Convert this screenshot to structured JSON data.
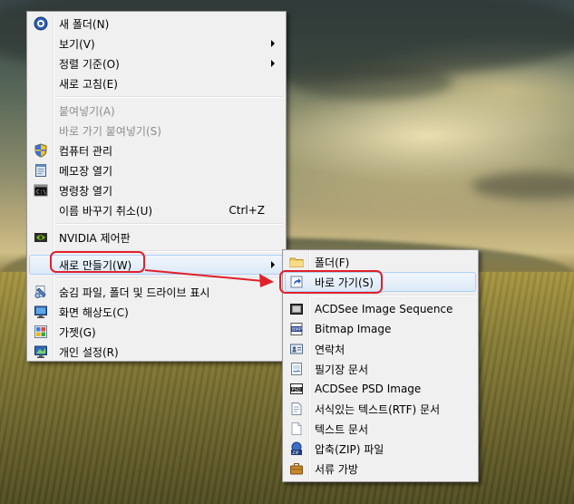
{
  "main_menu": {
    "items": [
      {
        "label": "새 폴더(N)",
        "icon": "new-folder-icon"
      },
      {
        "label": "보기(V)",
        "submenu": true
      },
      {
        "label": "정렬 기준(O)",
        "submenu": true
      },
      {
        "label": "새로 고침(E)"
      },
      {
        "label": "붙여넣기(A)",
        "disabled": true
      },
      {
        "label": "바로 가기 붙여넣기(S)",
        "disabled": true
      },
      {
        "label": "컴퓨터 관리",
        "icon": "shield-icon"
      },
      {
        "label": "메모장 열기",
        "icon": "notepad-icon"
      },
      {
        "label": "명령창 열기",
        "icon": "cmd-icon"
      },
      {
        "label": "이름 바꾸기 취소(U)",
        "shortcut": "Ctrl+Z"
      },
      {
        "label": "NVIDIA 제어판",
        "icon": "nvidia-icon"
      },
      {
        "label": "새로 만들기(W)",
        "submenu": true,
        "highlighted": true
      },
      {
        "label": "숨김 파일, 폴더 및 드라이브 표시",
        "icon": "hidden-files-icon"
      },
      {
        "label": "화면 해상도(C)",
        "icon": "display-icon"
      },
      {
        "label": "가젯(G)",
        "icon": "gadget-icon"
      },
      {
        "label": "개인 설정(R)",
        "icon": "personalize-icon"
      }
    ]
  },
  "new_submenu": {
    "items": [
      {
        "label": "폴더(F)",
        "icon": "folder-icon"
      },
      {
        "label": "바로 가기(S)",
        "icon": "shortcut-icon",
        "highlighted": true
      },
      {
        "label": "ACDSee Image Sequence",
        "icon": "acdsee-sequence-icon"
      },
      {
        "label": "Bitmap Image",
        "icon": "bitmap-icon"
      },
      {
        "label": "연락처",
        "icon": "contact-icon"
      },
      {
        "label": "필기장 문서",
        "icon": "journal-icon"
      },
      {
        "label": "ACDSee PSD Image",
        "icon": "psd-icon"
      },
      {
        "label": "서식있는 텍스트(RTF) 문서",
        "icon": "rtf-icon"
      },
      {
        "label": "텍스트 문서",
        "icon": "text-doc-icon"
      },
      {
        "label": "압축(ZIP) 파일",
        "icon": "zip-icon"
      },
      {
        "label": "서류 가방",
        "icon": "briefcase-icon"
      }
    ]
  },
  "colors": {
    "annotation": "#e0202a",
    "highlight_border": "#aecff7",
    "disabled_text": "#8d8d8d"
  }
}
